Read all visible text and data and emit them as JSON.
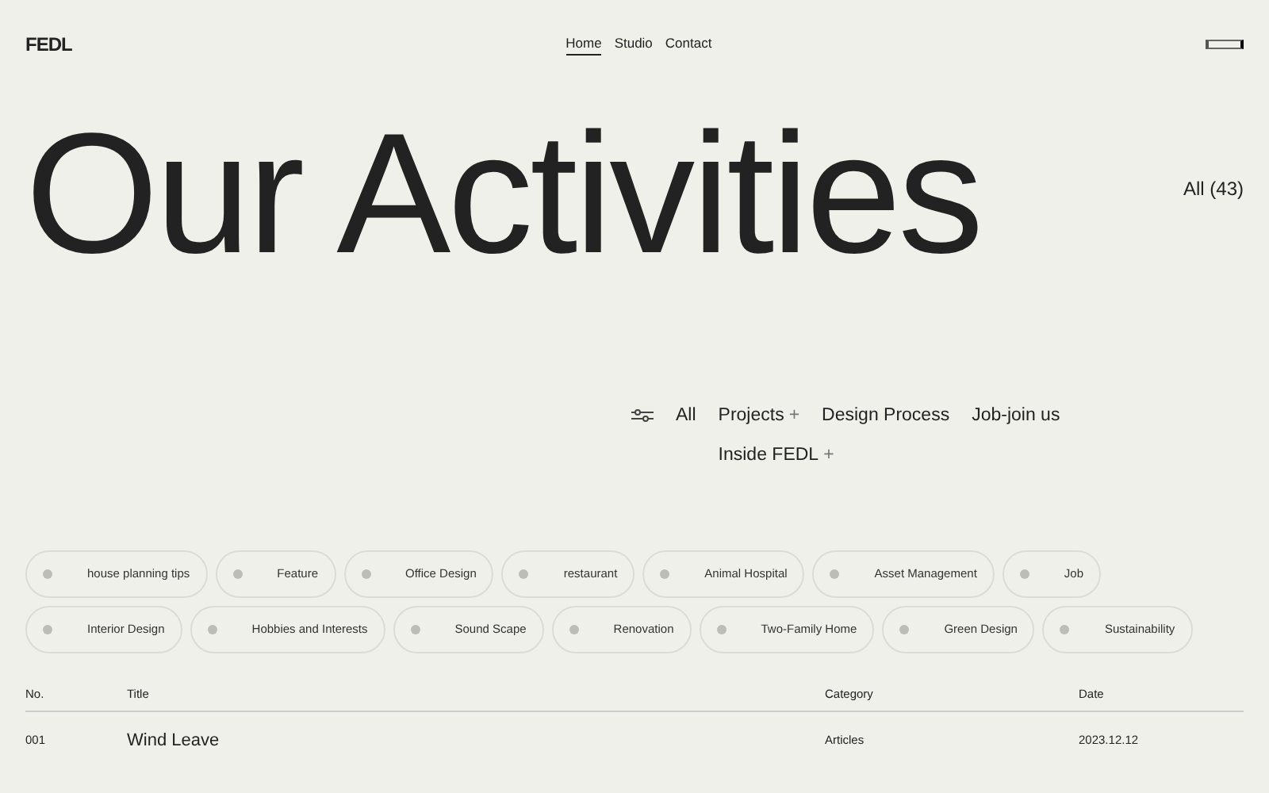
{
  "logo": "FEDL",
  "nav": [
    {
      "label": "Home",
      "selected": true
    },
    {
      "label": "Studio",
      "selected": false
    },
    {
      "label": "Contact",
      "selected": false
    }
  ],
  "heading": "Our Activities",
  "count": "All (43)",
  "filters": [
    {
      "label": "All"
    },
    {
      "label": "Projects",
      "marker": "+"
    },
    {
      "label": "Design Process"
    },
    {
      "label": "Job-join us"
    },
    {
      "label": "Inside FEDL",
      "marker": "+"
    }
  ],
  "tags": [
    "house planning tips",
    "Feature",
    "Office Design",
    "restaurant",
    "Animal Hospital",
    "Asset Management",
    "Job",
    "Interior Design",
    "Hobbies and Interests",
    "Sound Scape",
    "Renovation",
    "Two-Family Home",
    "Green Design",
    "Sustainability"
  ],
  "table": {
    "columns": [
      "No.",
      "Title",
      "Category",
      "Date"
    ],
    "rows": [
      [
        "001",
        "Wind Leave",
        "Articles",
        "2023.12.12"
      ]
    ]
  }
}
